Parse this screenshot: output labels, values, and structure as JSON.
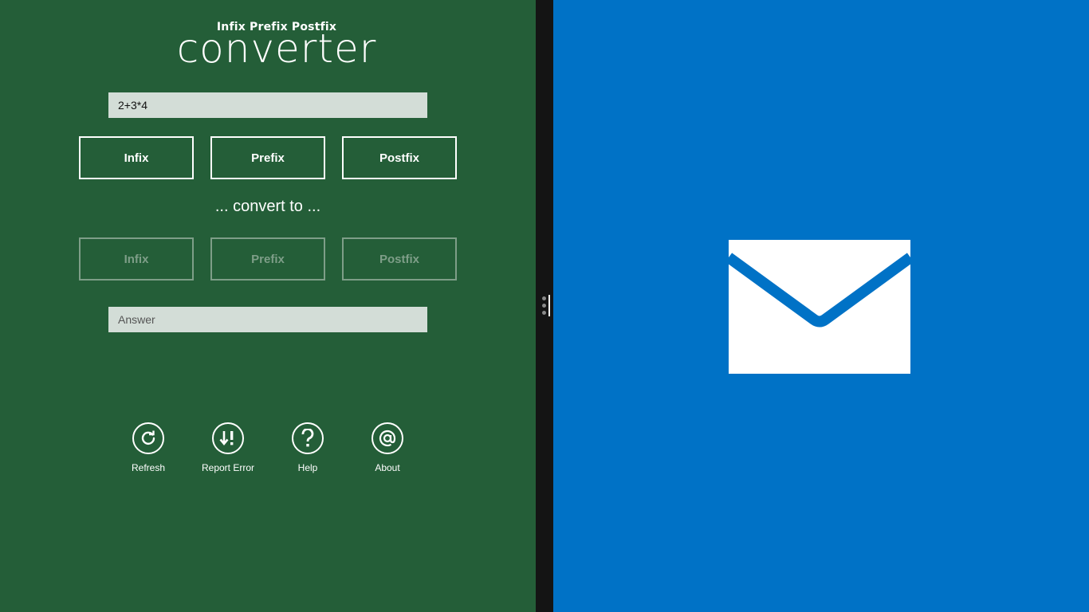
{
  "app": {
    "subtitle": "Infix Prefix Postfix",
    "title": "converter"
  },
  "input": {
    "value": "2+3*4",
    "placeholder": ""
  },
  "from_modes": [
    "Infix",
    "Prefix",
    "Postfix"
  ],
  "convert_label": "... convert to ...",
  "to_modes": [
    "Infix",
    "Prefix",
    "Postfix"
  ],
  "answer": {
    "value": "",
    "placeholder": "Answer"
  },
  "actions": [
    {
      "label": "Refresh",
      "icon": "refresh-icon"
    },
    {
      "label": "Report Error",
      "icon": "report-error-icon"
    },
    {
      "label": "Help",
      "icon": "help-icon"
    },
    {
      "label": "About",
      "icon": "at-icon"
    }
  ],
  "right_pane": {
    "icon": "mail-icon"
  },
  "colors": {
    "app_background": "#245e38",
    "mail_background": "#0072c6",
    "divider": "#141414"
  }
}
